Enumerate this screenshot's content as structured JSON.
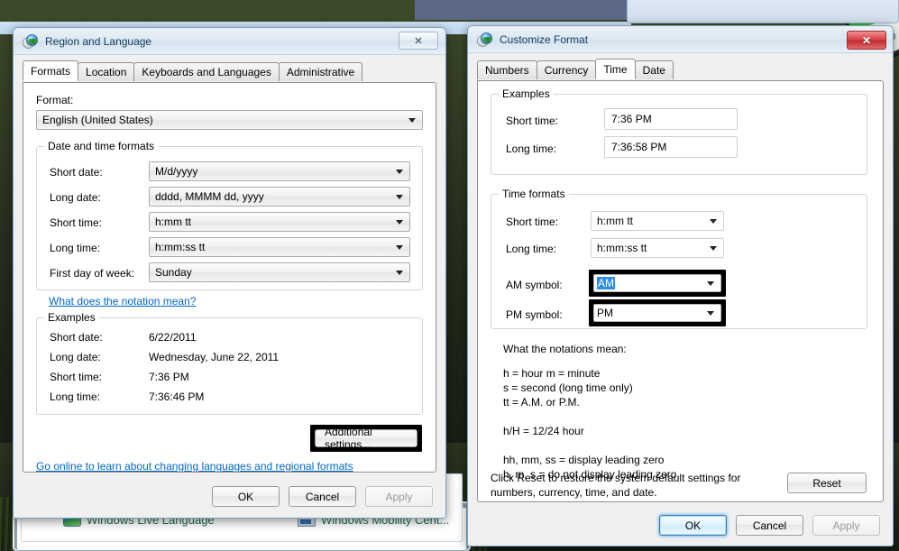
{
  "background": {
    "item1_label": "Windows Live Language",
    "item2_label": "Windows Mobility Cent...",
    "gauge_tick": "10",
    "minimize_glyph": "—",
    "maximize_glyph": "□",
    "close_glyph": "✕"
  },
  "region_dialog": {
    "title": "Region and Language",
    "close_glyph": "✕",
    "tabs": [
      {
        "label": "Formats",
        "active": true
      },
      {
        "label": "Location",
        "active": false
      },
      {
        "label": "Keyboards and Languages",
        "active": false
      },
      {
        "label": "Administrative",
        "active": false
      }
    ],
    "format_label": "Format:",
    "format_value": "English (United States)",
    "datetime_group": {
      "legend": "Date and time formats",
      "rows": [
        {
          "label": "Short date:",
          "value": "M/d/yyyy"
        },
        {
          "label": "Long date:",
          "value": "dddd, MMMM dd, yyyy"
        },
        {
          "label": "Short time:",
          "value": "h:mm tt"
        },
        {
          "label": "Long time:",
          "value": "h:mm:ss tt"
        },
        {
          "label": "First day of week:",
          "value": "Sunday"
        }
      ],
      "notation_link": "What does the notation mean?"
    },
    "examples_group": {
      "legend": "Examples",
      "rows": [
        {
          "label": "Short date:",
          "value": "6/22/2011"
        },
        {
          "label": "Long date:",
          "value": "Wednesday, June 22, 2011"
        },
        {
          "label": "Short time:",
          "value": "7:36 PM"
        },
        {
          "label": "Long time:",
          "value": "7:36:46 PM"
        }
      ]
    },
    "additional_settings_label": "Additional settings...",
    "online_link": "Go online to learn about changing languages and regional formats",
    "buttons": {
      "ok": "OK",
      "cancel": "Cancel",
      "apply": "Apply"
    }
  },
  "customize_dialog": {
    "title": "Customize Format",
    "close_glyph": "✕",
    "tabs": [
      {
        "label": "Numbers",
        "active": false
      },
      {
        "label": "Currency",
        "active": false
      },
      {
        "label": "Time",
        "active": true
      },
      {
        "label": "Date",
        "active": false
      }
    ],
    "examples_group": {
      "legend": "Examples",
      "rows": [
        {
          "label": "Short time:",
          "value": "7:36 PM"
        },
        {
          "label": "Long time:",
          "value": "7:36:58 PM"
        }
      ]
    },
    "time_formats_group": {
      "legend": "Time formats",
      "rows": [
        {
          "label": "Short time:",
          "value": "h:mm tt",
          "highlighted": false,
          "selected": false
        },
        {
          "label": "Long time:",
          "value": "h:mm:ss tt",
          "highlighted": false,
          "selected": false
        },
        {
          "label": "AM symbol:",
          "value": "AM",
          "highlighted": true,
          "selected": true
        },
        {
          "label": "PM symbol:",
          "value": "PM",
          "highlighted": true,
          "selected": false
        }
      ]
    },
    "notations_title": "What the notations mean:",
    "notations_body": "h = hour   m = minute\ns = second (long time only)\ntt = A.M. or P.M.\n\nh/H = 12/24 hour\n\nhh, mm, ss = display leading zero\nh, m, s = do not display leading zero",
    "reset_text": "Click Reset to restore the system default settings for\nnumbers, currency, time, and date.",
    "reset_button": "Reset",
    "buttons": {
      "ok": "OK",
      "cancel": "Cancel",
      "apply": "Apply"
    }
  },
  "colors": {
    "accent_selection": "#2f8de4",
    "link": "#0066cc",
    "highlight_border": "#000000",
    "title_text": "#143c64"
  }
}
